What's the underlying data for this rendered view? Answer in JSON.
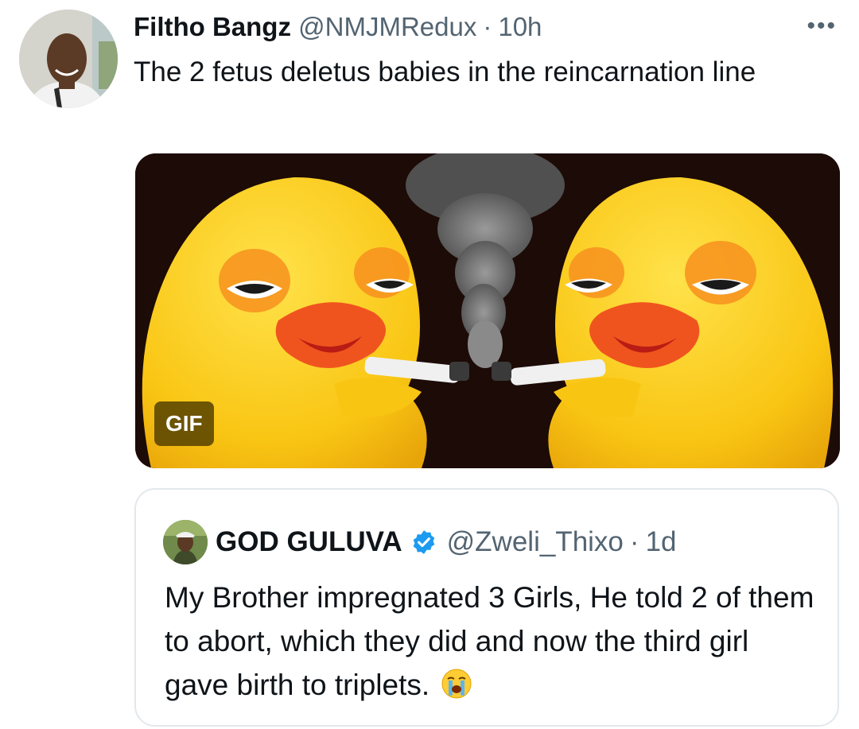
{
  "tweet": {
    "author_name": "Filtho Bangz",
    "author_handle": "@NMJMRedux",
    "separator": "·",
    "time": "10h",
    "more_icon": "more-horizontal-icon",
    "text": "The 2 fetus deletus babies in the reincarnation line",
    "media": {
      "badge": "GIF"
    }
  },
  "quoted": {
    "author_name": "GOD GULUVA",
    "verified_icon": "verified-badge-icon",
    "author_handle": "@Zweli_Thixo",
    "separator": "·",
    "time": "1d",
    "text": "My Brother impregnated 3 Girls, He told 2 of them to abort, which they did and now the third girl gave birth to triplets.",
    "emoji": "loudly-crying-face-icon"
  },
  "colors": {
    "text_primary": "#0f1419",
    "text_secondary": "#536471",
    "verified_blue": "#1d9bf0",
    "border": "#e3e8ec"
  }
}
